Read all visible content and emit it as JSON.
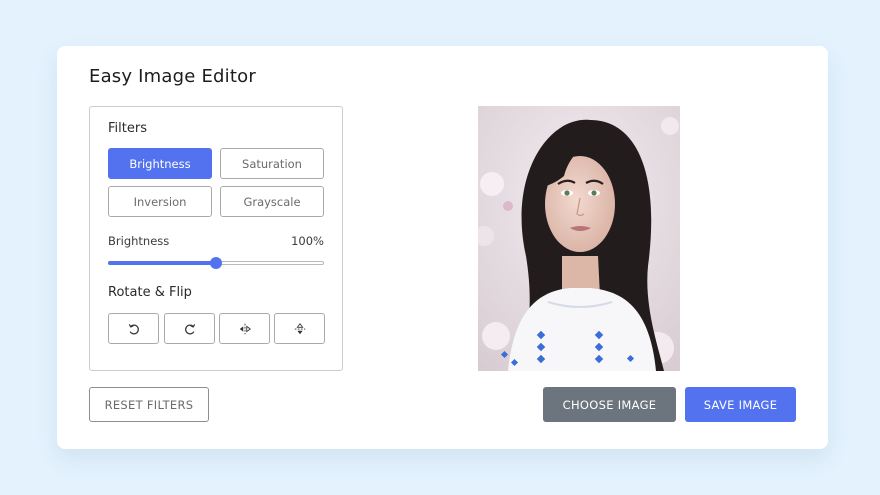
{
  "app": {
    "title": "Easy Image Editor"
  },
  "filters": {
    "heading": "Filters",
    "buttons": [
      {
        "label": "Brightness",
        "active": true
      },
      {
        "label": "Saturation",
        "active": false
      },
      {
        "label": "Inversion",
        "active": false
      },
      {
        "label": "Grayscale",
        "active": false
      }
    ]
  },
  "slider": {
    "label": "Brightness",
    "value_text": "100%",
    "value": 100,
    "max": 200
  },
  "rotate": {
    "heading": "Rotate & Flip",
    "buttons": [
      {
        "icon": "rotate-left-icon"
      },
      {
        "icon": "rotate-right-icon"
      },
      {
        "icon": "flip-horizontal-icon"
      },
      {
        "icon": "flip-vertical-icon"
      }
    ]
  },
  "actions": {
    "reset_label": "RESET FILTERS",
    "choose_label": "CHOOSE IMAGE",
    "save_label": "SAVE IMAGE"
  },
  "colors": {
    "page_background": "#e3f2fd",
    "accent": "#5372f0",
    "choose_button": "#6c757d"
  }
}
